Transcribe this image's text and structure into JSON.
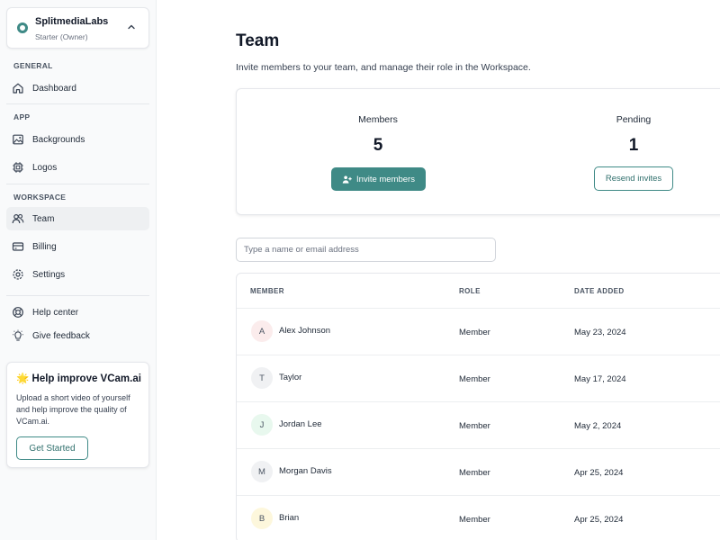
{
  "org": {
    "name": "SplitmediaLabs",
    "plan": "Starter (Owner)"
  },
  "sidebar": {
    "general_label": "GENERAL",
    "app_label": "APP",
    "workspace_label": "WORKSPACE",
    "items": [
      {
        "label": "Dashboard",
        "icon": "home-icon"
      },
      {
        "label": "Backgrounds",
        "icon": "image-icon"
      },
      {
        "label": "Logos",
        "icon": "chip-icon"
      },
      {
        "label": "Team",
        "icon": "users-icon"
      },
      {
        "label": "Billing",
        "icon": "credit-card-icon"
      },
      {
        "label": "Settings",
        "icon": "gear-icon"
      },
      {
        "label": "Help center",
        "icon": "lifebuoy-icon"
      },
      {
        "label": "Give feedback",
        "icon": "lightbulb-icon"
      }
    ],
    "promo": {
      "title": "🌟 Help improve VCam.ai",
      "body": "Upload a short video of yourself and help improve the quality of VCam.ai.",
      "button": "Get Started"
    }
  },
  "main": {
    "title": "Team",
    "subtitle": "Invite members to your team, and manage their role in the Workspace.",
    "stats": {
      "members_label": "Members",
      "members_value": "5",
      "pending_label": "Pending",
      "pending_value": "1",
      "invite_button": "Invite members",
      "resend_button": "Resend invites"
    },
    "search": {
      "placeholder": "Type a name or email address"
    },
    "table": {
      "headers": {
        "member": "MEMBER",
        "role": "ROLE",
        "date": "DATE ADDED"
      },
      "rows": [
        {
          "initial": "A",
          "name": "Alex Johnson",
          "role": "Member",
          "date": "May 23, 2024",
          "avatar_bg": "#fbecec"
        },
        {
          "initial": "T",
          "name": "Taylor",
          "role": "Member",
          "date": "May 17, 2024",
          "avatar_bg": "#f0f1f3"
        },
        {
          "initial": "J",
          "name": "Jordan Lee",
          "role": "Member",
          "date": "May 2, 2024",
          "avatar_bg": "#e8f8ee"
        },
        {
          "initial": "M",
          "name": "Morgan Davis",
          "role": "Member",
          "date": "Apr 25, 2024",
          "avatar_bg": "#f0f1f3"
        },
        {
          "initial": "B",
          "name": "Brian",
          "role": "Member",
          "date": "Apr 25, 2024",
          "avatar_bg": "#fdf7dc"
        }
      ]
    }
  },
  "colors": {
    "accent": "#3f8a86",
    "active_nav": "#eef0f2",
    "sidebar_bg": "#f9fafb"
  }
}
